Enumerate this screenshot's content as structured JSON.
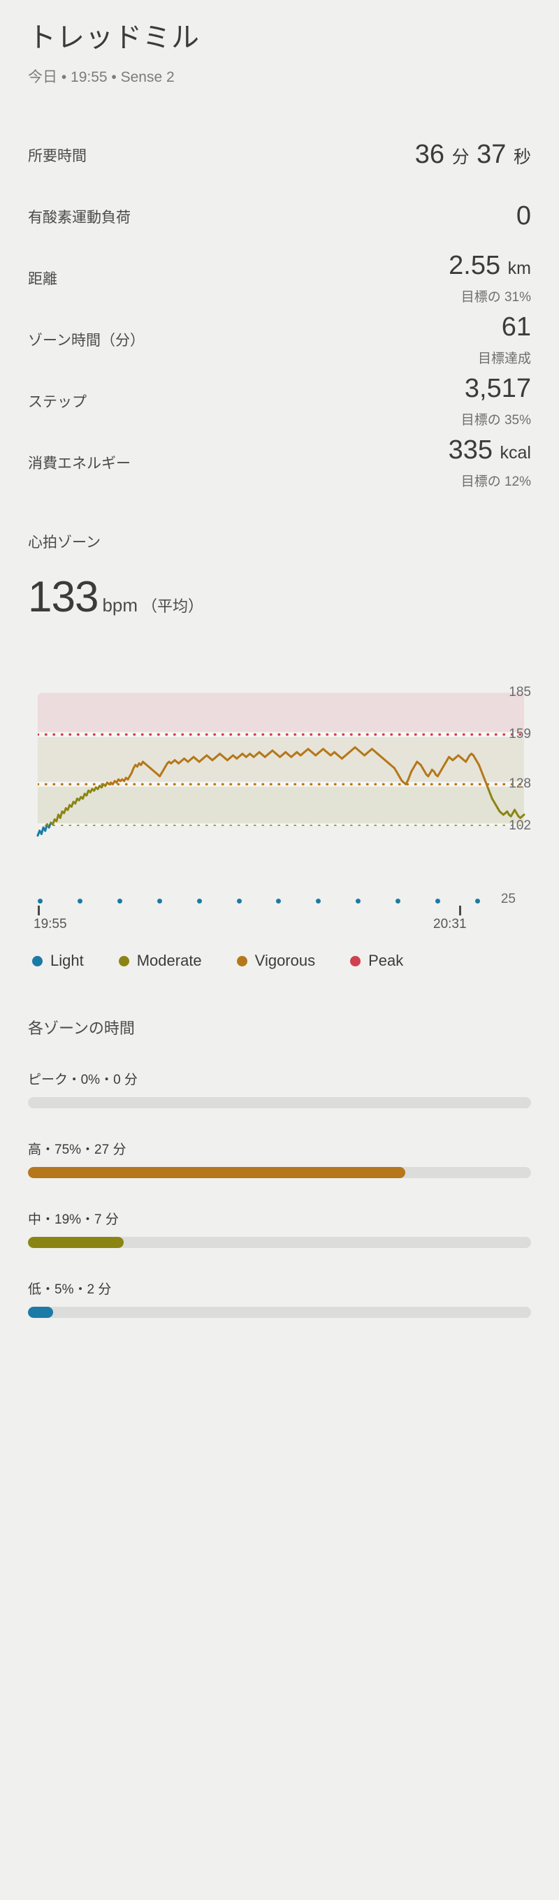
{
  "header": {
    "title": "トレッドミル",
    "subtitle": "今日 • 19:55 • Sense 2"
  },
  "stats": [
    {
      "label": "所要時間",
      "value": "36",
      "unit": "分",
      "value2": "37",
      "unit2": "秒",
      "sub": ""
    },
    {
      "label": "有酸素運動負荷",
      "value": "0",
      "unit": "",
      "sub": ""
    },
    {
      "label": "距離",
      "value": "2.55",
      "unit": "km",
      "sub": "目標の 31%"
    },
    {
      "label": "ゾーン時間（分）",
      "value": "61",
      "unit": "",
      "sub": "目標達成"
    },
    {
      "label": "ステップ",
      "value": "3,517",
      "unit": "",
      "sub": "目標の 35%"
    },
    {
      "label": "消費エネルギー",
      "value": "335",
      "unit": "kcal",
      "sub": "目標の 12%"
    }
  ],
  "heart_rate": {
    "section_title": "心拍ゾーン",
    "value": "133",
    "unit": "bpm",
    "qualifier": "（平均）"
  },
  "timeline": {
    "start_time": "19:55",
    "end_time": "20:31",
    "count_label": "25"
  },
  "legend": [
    {
      "label": "Light",
      "color": "#1b7ba6"
    },
    {
      "label": "Moderate",
      "color": "#8b8413"
    },
    {
      "label": "Vigorous",
      "color": "#b5771a"
    },
    {
      "label": "Peak",
      "color": "#cf4050"
    }
  ],
  "zones": {
    "title": "各ゾーンの時間",
    "rows": [
      {
        "label": "ピーク・0%・0 分",
        "percent": 0,
        "color": "#cf4050"
      },
      {
        "label": "高・75%・27 分",
        "percent": 75,
        "color": "#b5771a"
      },
      {
        "label": "中・19%・7 分",
        "percent": 19,
        "color": "#8b8413"
      },
      {
        "label": "低・5%・2 分",
        "percent": 5,
        "color": "#1b7ba6"
      }
    ]
  },
  "chart_data": {
    "type": "line",
    "title": "心拍ゾーン",
    "xlabel": "",
    "ylabel": "bpm",
    "ylim": [
      102,
      185
    ],
    "yticks": [
      102,
      128,
      159,
      185
    ],
    "ytick_labels": [
      "102",
      "159",
      "128",
      "185"
    ],
    "x_start": "19:55",
    "x_end": "20:31",
    "grid": false,
    "legend_position": "below",
    "zone_bands": [
      {
        "name": "Peak",
        "from": 159,
        "to": 185,
        "fill": "#ecdcdd",
        "line_color": "#cf4050"
      },
      {
        "name": "Vigorous",
        "from": 128,
        "to": 159,
        "fill": "#e6e4d8",
        "line_color": "#b5771a"
      },
      {
        "name": "Moderate",
        "from": 102,
        "to": 128,
        "fill": "#e2e3d4",
        "line_color": "#8b8413"
      }
    ],
    "series": [
      {
        "name": "Heart rate",
        "values": [
          96,
          99,
          97,
          101,
          99,
          103,
          101,
          104,
          103,
          106,
          105,
          109,
          107,
          111,
          110,
          113,
          112,
          115,
          114,
          117,
          116,
          119,
          118,
          120,
          119,
          122,
          121,
          124,
          123,
          125,
          124,
          126,
          125,
          127,
          126,
          128,
          127,
          129,
          128,
          129,
          128,
          130,
          129,
          131,
          130,
          131,
          130,
          132,
          131,
          133,
          135,
          138,
          140,
          139,
          141,
          140,
          142,
          141,
          140,
          139,
          138,
          137,
          136,
          135,
          134,
          133,
          135,
          137,
          139,
          141,
          142,
          141,
          142,
          143,
          142,
          141,
          142,
          143,
          144,
          143,
          142,
          143,
          144,
          145,
          144,
          143,
          142,
          143,
          144,
          145,
          146,
          145,
          144,
          143,
          144,
          145,
          146,
          147,
          146,
          145,
          144,
          143,
          144,
          145,
          146,
          145,
          144,
          145,
          146,
          147,
          146,
          145,
          146,
          147,
          146,
          145,
          146,
          147,
          148,
          147,
          146,
          145,
          146,
          147,
          148,
          149,
          148,
          147,
          146,
          145,
          146,
          147,
          148,
          147,
          146,
          145,
          146,
          147,
          148,
          147,
          146,
          147,
          148,
          149,
          150,
          149,
          148,
          147,
          146,
          147,
          148,
          149,
          150,
          149,
          148,
          147,
          146,
          147,
          148,
          147,
          146,
          145,
          144,
          145,
          146,
          147,
          148,
          149,
          150,
          151,
          150,
          149,
          148,
          147,
          146,
          147,
          148,
          149,
          150,
          149,
          148,
          147,
          146,
          145,
          144,
          143,
          142,
          141,
          140,
          139,
          138,
          136,
          134,
          132,
          130,
          129,
          128,
          130,
          133,
          136,
          138,
          140,
          142,
          141,
          140,
          138,
          136,
          134,
          133,
          135,
          137,
          136,
          134,
          133,
          135,
          137,
          139,
          141,
          143,
          145,
          144,
          143,
          144,
          145,
          146,
          145,
          144,
          143,
          142,
          144,
          146,
          147,
          146,
          144,
          142,
          140,
          137,
          134,
          131,
          128,
          125,
          122,
          119,
          117,
          115,
          113,
          111,
          110,
          109,
          110,
          111,
          109,
          108,
          110,
          112,
          110,
          108,
          107,
          108,
          109
        ]
      }
    ]
  }
}
